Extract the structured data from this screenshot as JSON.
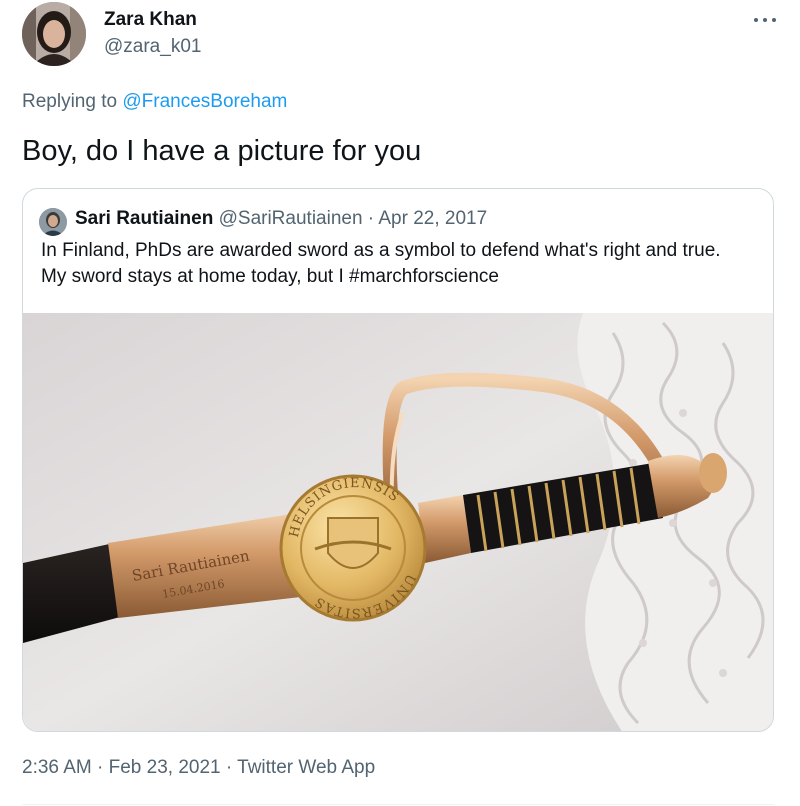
{
  "author": {
    "name": "Zara Khan",
    "handle": "@zara_k01"
  },
  "reply": {
    "prefix": "Replying to ",
    "to_handle": "@FrancesBoreham"
  },
  "tweet": {
    "text": "Boy, do I have a picture for you"
  },
  "quoted": {
    "name": "Sari Rautiainen",
    "handle": "@SariRautiainen",
    "separator": " · ",
    "date": "Apr 22, 2017",
    "text": "In Finland, PhDs are awarded sword as a symbol to defend what's right and true. My sword stays at home today, but I #marchforscience",
    "image": {
      "medallion_top": "HELSINGIENSIS",
      "medallion_bottom": "UNIVERSITAS",
      "engraving_name": "Sari Rautiainen",
      "engraving_date": "15.04.2016"
    }
  },
  "footer": {
    "time": "2:36 AM",
    "separator": " · ",
    "date": "Feb 23, 2021",
    "separator2": " · ",
    "app": "Twitter Web App"
  }
}
